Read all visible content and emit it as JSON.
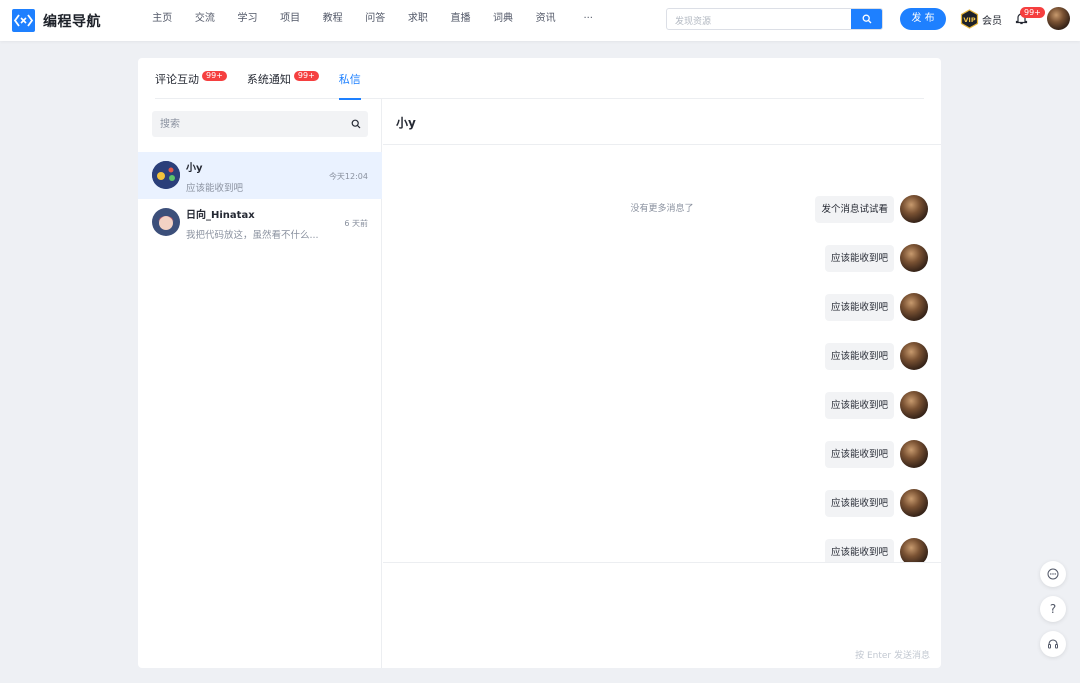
{
  "brand": {
    "name": "编程导航"
  },
  "nav": {
    "items": [
      {
        "label": "主页"
      },
      {
        "label": "交流"
      },
      {
        "label": "学习"
      },
      {
        "label": "项目"
      },
      {
        "label": "教程"
      },
      {
        "label": "问答"
      },
      {
        "label": "求职"
      },
      {
        "label": "直播"
      },
      {
        "label": "词典"
      },
      {
        "label": "资讯"
      },
      {
        "label": "···"
      }
    ]
  },
  "search": {
    "placeholder": "发现资源"
  },
  "header": {
    "publish_label": "发 布",
    "vip_label": "会员",
    "notification_badge": "99+"
  },
  "tabs": [
    {
      "label": "评论互动",
      "badge": "99+"
    },
    {
      "label": "系统通知",
      "badge": "99+"
    },
    {
      "label": "私信",
      "badge": ""
    }
  ],
  "conversation_search": {
    "placeholder": "搜索"
  },
  "conversations": [
    {
      "name": "小y",
      "preview": "应该能收到吧",
      "time": "今天12:04"
    },
    {
      "name": "日向_Hinatax",
      "preview": "我把代码放这，虽然看不什么...",
      "time": "6 天前"
    }
  ],
  "chat": {
    "title": "小y",
    "no_more": "没有更多消息了",
    "messages": [
      {
        "text": "发个消息试试看"
      },
      {
        "text": "应该能收到吧"
      },
      {
        "text": "应该能收到吧"
      },
      {
        "text": "应该能收到吧"
      },
      {
        "text": "应该能收到吧"
      },
      {
        "text": "应该能收到吧"
      },
      {
        "text": "应该能收到吧"
      },
      {
        "text": "应该能收到吧"
      }
    ],
    "send_hint": "按 Enter 发送消息"
  },
  "colors": {
    "accent": "#1e80ff",
    "badge": "#f53f3f"
  },
  "float_buttons": [
    {
      "icon": "chat-icon"
    },
    {
      "icon": "help-icon",
      "glyph": "?"
    },
    {
      "icon": "headset-icon"
    }
  ]
}
